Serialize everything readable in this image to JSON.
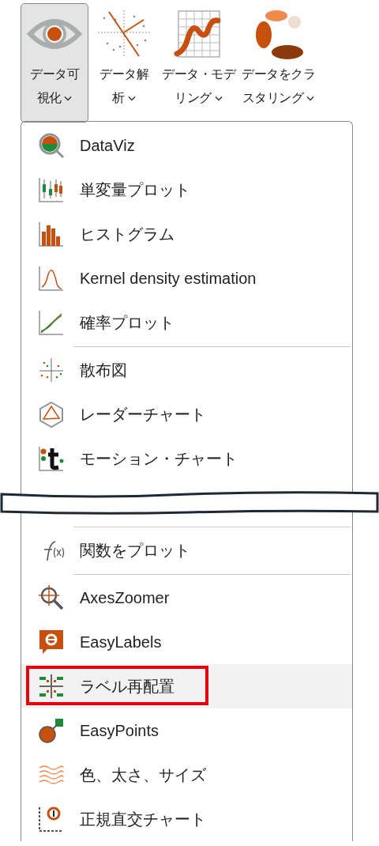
{
  "ribbon": {
    "buttons": [
      {
        "label_lines": [
          "データ可",
          "視化"
        ],
        "selected": true
      },
      {
        "label_lines": [
          "データ解",
          "析"
        ],
        "selected": false
      },
      {
        "label_lines": [
          "データ・モデ",
          "リング"
        ],
        "selected": false
      },
      {
        "label_lines": [
          "データをクラ",
          "スタリング"
        ],
        "selected": false
      }
    ]
  },
  "menu": {
    "items": [
      {
        "kind": "item",
        "label": "DataViz",
        "selected": false,
        "marked": false
      },
      {
        "kind": "item",
        "label": "単変量プロット",
        "selected": false,
        "marked": false
      },
      {
        "kind": "item",
        "label": "ヒストグラム",
        "selected": false,
        "marked": false
      },
      {
        "kind": "item",
        "label": "Kernel density estimation",
        "selected": false,
        "marked": false
      },
      {
        "kind": "item",
        "label": "確率プロット",
        "selected": false,
        "marked": false
      },
      {
        "kind": "separator"
      },
      {
        "kind": "item",
        "label": "散布図",
        "selected": false,
        "marked": false
      },
      {
        "kind": "item",
        "label": "レーダーチャート",
        "selected": false,
        "marked": false
      },
      {
        "kind": "item",
        "label": "モーション・チャート",
        "selected": false,
        "marked": false
      },
      {
        "kind": "cut"
      },
      {
        "kind": "separator"
      },
      {
        "kind": "item",
        "label": "関数をプロット",
        "selected": false,
        "marked": false
      },
      {
        "kind": "separator"
      },
      {
        "kind": "item",
        "label": "AxesZoomer",
        "selected": false,
        "marked": false
      },
      {
        "kind": "item",
        "label": "EasyLabels",
        "selected": false,
        "marked": false
      },
      {
        "kind": "item",
        "label": "ラベル再配置",
        "selected": true,
        "marked": true
      },
      {
        "kind": "item",
        "label": "EasyPoints",
        "selected": false,
        "marked": false
      },
      {
        "kind": "item",
        "label": "色、太さ、サイズ",
        "selected": false,
        "marked": false
      },
      {
        "kind": "item",
        "label": "正規直交チャート",
        "selected": false,
        "marked": false
      }
    ]
  }
}
